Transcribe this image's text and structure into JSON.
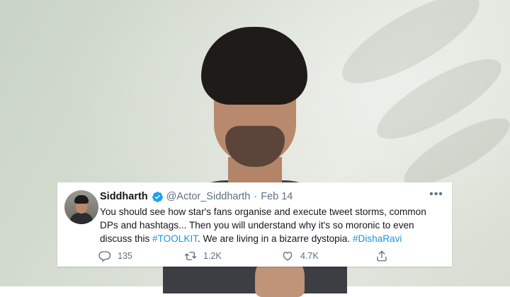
{
  "tweet": {
    "author_name": "Siddharth",
    "handle": "@Actor_Siddharth",
    "separator": "·",
    "date": "Feb 14",
    "more": "•••",
    "text_intro": "You should see how star's fans organise and execute tweet storms, common DPs and hashtags... Then you will understand why it's so moronic to even discuss this ",
    "hashtag_toolkit": "#TOOLKIT",
    "text_middle": ". We are living in a bizarre dystopia. ",
    "hashtag_disha": "#DishaRavi",
    "reply_count": "135",
    "retweet_count": "1.2K",
    "like_count": "4.7K",
    "verified_icon": "verified-badge-icon",
    "link_color": "#1b95e0",
    "verified_color": "#1da1f2"
  }
}
